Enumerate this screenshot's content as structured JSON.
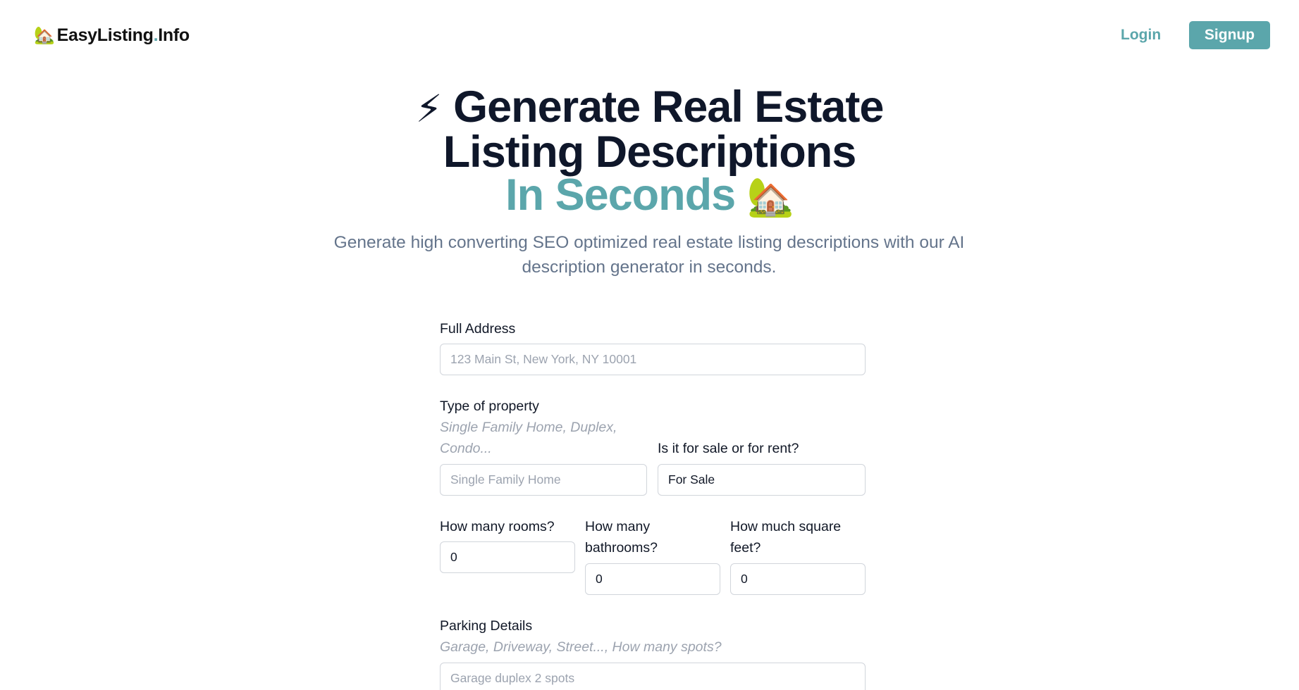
{
  "nav": {
    "logo_icon": "🏡",
    "logo_name": "EasyListing",
    "logo_dot": ".",
    "logo_suffix": "Info",
    "login_label": "Login",
    "signup_label": "Signup"
  },
  "hero": {
    "bolt_icon": "⚡",
    "line1": "Generate Real Estate",
    "line2": "Listing Descriptions",
    "line3_accent": "In Seconds",
    "house_icon": "🏡",
    "subtitle": "Generate high converting SEO optimized real estate listing descriptions with our AI description generator in seconds."
  },
  "colors": {
    "accent": "#5ba6ab",
    "heading": "#0f172a",
    "muted": "#64748b"
  },
  "form": {
    "address": {
      "label": "Full Address",
      "placeholder": "123 Main St, New York, NY 10001",
      "value": ""
    },
    "property_type": {
      "label": "Type of property",
      "hint": "Single Family Home, Duplex, Condo...",
      "placeholder": "Single Family Home",
      "value": ""
    },
    "sale_or_rent": {
      "label": "Is it for sale or for rent?",
      "value": "For Sale"
    },
    "rooms": {
      "label": "How many rooms?",
      "value": "0"
    },
    "bathrooms": {
      "label": "How many bathrooms?",
      "value": "0"
    },
    "square_feet": {
      "label": "How much square feet?",
      "value": "0"
    },
    "parking": {
      "label": "Parking Details",
      "hint": "Garage, Driveway, Street..., How many spots?",
      "placeholder": "Garage duplex 2 spots",
      "value": ""
    }
  }
}
